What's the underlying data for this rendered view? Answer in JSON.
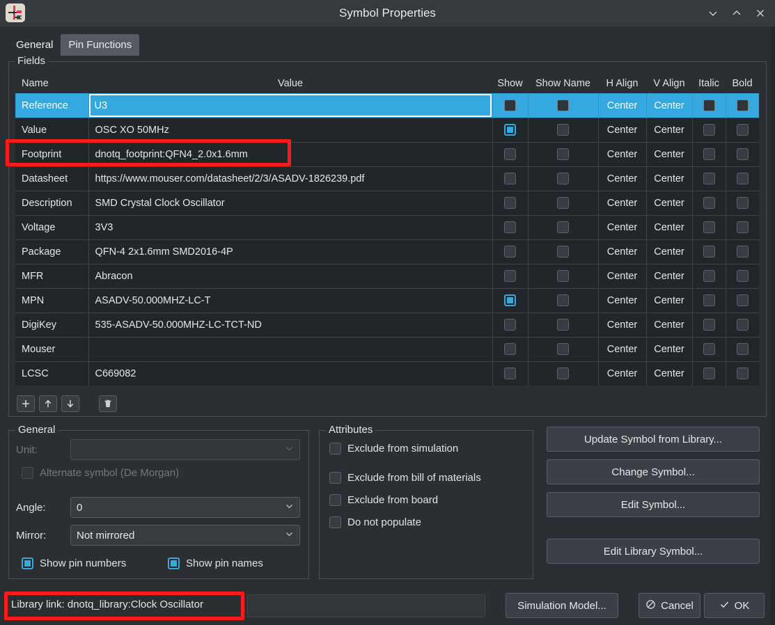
{
  "window": {
    "title": "Symbol Properties",
    "icon": "kicad-eeschema-icon",
    "minimize": "∨",
    "maximize": "∧",
    "close": "×"
  },
  "tabs": [
    {
      "label": "General",
      "active": true
    },
    {
      "label": "Pin Functions",
      "active": false
    }
  ],
  "fields_group": {
    "label": "Fields",
    "columns": [
      "Name",
      "Value",
      "Show",
      "Show Name",
      "H Align",
      "V Align",
      "Italic",
      "Bold"
    ],
    "rows": [
      {
        "name": "Reference",
        "value": "U3",
        "show": false,
        "show_name": false,
        "h_align": "Center",
        "v_align": "Center",
        "italic": false,
        "bold": false,
        "selected": true,
        "editing": true
      },
      {
        "name": "Value",
        "value": "OSC XO 50MHz",
        "show": true,
        "show_name": false,
        "h_align": "Center",
        "v_align": "Center",
        "italic": false,
        "bold": false,
        "selected": false,
        "editing": false
      },
      {
        "name": "Footprint",
        "value": "dnotq_footprint:QFN4_2.0x1.6mm",
        "show": false,
        "show_name": false,
        "h_align": "Center",
        "v_align": "Center",
        "italic": false,
        "bold": false,
        "selected": false,
        "editing": false
      },
      {
        "name": "Datasheet",
        "value": "https://www.mouser.com/datasheet/2/3/ASADV-1826239.pdf",
        "show": false,
        "show_name": false,
        "h_align": "Center",
        "v_align": "Center",
        "italic": false,
        "bold": false,
        "selected": false,
        "editing": false
      },
      {
        "name": "Description",
        "value": "SMD Crystal Clock Oscillator",
        "show": false,
        "show_name": false,
        "h_align": "Center",
        "v_align": "Center",
        "italic": false,
        "bold": false,
        "selected": false,
        "editing": false
      },
      {
        "name": "Voltage",
        "value": "3V3",
        "show": false,
        "show_name": false,
        "h_align": "Center",
        "v_align": "Center",
        "italic": false,
        "bold": false,
        "selected": false,
        "editing": false
      },
      {
        "name": "Package",
        "value": "QFN-4 2x1.6mm SMD2016-4P",
        "show": false,
        "show_name": false,
        "h_align": "Center",
        "v_align": "Center",
        "italic": false,
        "bold": false,
        "selected": false,
        "editing": false
      },
      {
        "name": "MFR",
        "value": "Abracon",
        "show": false,
        "show_name": false,
        "h_align": "Center",
        "v_align": "Center",
        "italic": false,
        "bold": false,
        "selected": false,
        "editing": false
      },
      {
        "name": "MPN",
        "value": "ASADV-50.000MHZ-LC-T",
        "show": true,
        "show_name": false,
        "h_align": "Center",
        "v_align": "Center",
        "italic": false,
        "bold": false,
        "selected": false,
        "editing": false
      },
      {
        "name": "DigiKey",
        "value": "535-ASADV-50.000MHZ-LC-TCT-ND",
        "show": false,
        "show_name": false,
        "h_align": "Center",
        "v_align": "Center",
        "italic": false,
        "bold": false,
        "selected": false,
        "editing": false
      },
      {
        "name": "Mouser",
        "value": "",
        "show": false,
        "show_name": false,
        "h_align": "Center",
        "v_align": "Center",
        "italic": false,
        "bold": false,
        "selected": false,
        "editing": false
      },
      {
        "name": "LCSC",
        "value": "C669082",
        "show": false,
        "show_name": false,
        "h_align": "Center",
        "v_align": "Center",
        "italic": false,
        "bold": false,
        "selected": false,
        "editing": false
      }
    ],
    "toolbar": {
      "add": "+",
      "move_up": "↑",
      "move_down": "↓",
      "delete": "delete-icon"
    }
  },
  "general": {
    "label": "General",
    "unit_label": "Unit:",
    "unit_value": "",
    "alternate_symbol_label": "Alternate symbol (De Morgan)",
    "alternate_symbol_checked": false,
    "angle_label": "Angle:",
    "angle_value": "0",
    "mirror_label": "Mirror:",
    "mirror_value": "Not mirrored",
    "show_pin_numbers_label": "Show pin numbers",
    "show_pin_numbers_checked": true,
    "show_pin_names_label": "Show pin names",
    "show_pin_names_checked": true
  },
  "attributes": {
    "label": "Attributes",
    "items": [
      {
        "label": "Exclude from simulation",
        "checked": false
      },
      {
        "label": "Exclude from bill of materials",
        "checked": false
      },
      {
        "label": "Exclude from board",
        "checked": false
      },
      {
        "label": "Do not populate",
        "checked": false
      }
    ]
  },
  "actions": {
    "update_symbol": "Update Symbol from Library...",
    "change_symbol": "Change Symbol...",
    "edit_symbol": "Edit Symbol...",
    "edit_library_symbol": "Edit Library Symbol..."
  },
  "bottom": {
    "library_link": "Library link: dnotq_library:Clock Oscillator",
    "simulation_model": "Simulation Model...",
    "cancel": "Cancel",
    "ok": "OK"
  },
  "colors": {
    "accent": "#36a8e0",
    "annotation": "#ff1a1a",
    "window_bg": "#2b2f33",
    "titlebar_bg": "#353a3f",
    "row_bg": "#21262a"
  }
}
